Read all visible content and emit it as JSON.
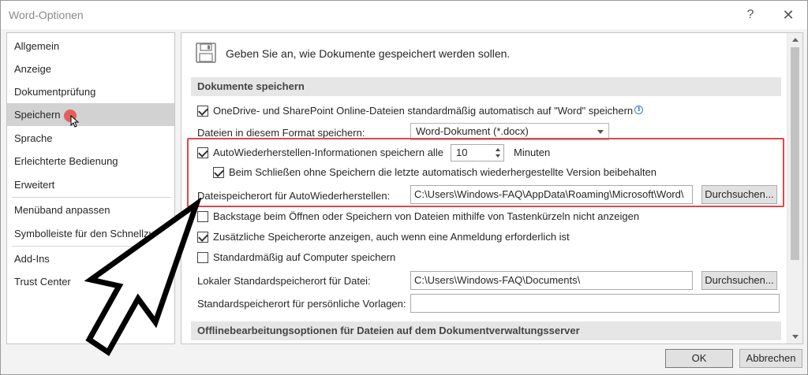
{
  "window": {
    "title": "Word-Optionen",
    "help_label": "?",
    "close_label": "✕"
  },
  "sidebar": {
    "items": [
      {
        "label": "Allgemein",
        "selected": false
      },
      {
        "label": "Anzeige",
        "selected": false
      },
      {
        "label": "Dokumentprüfung",
        "selected": false
      },
      {
        "label": "Speichern",
        "selected": true
      },
      {
        "label": "Sprache",
        "selected": false
      },
      {
        "label": "Erleichterte Bedienung",
        "selected": false
      },
      {
        "label": "Erweitert",
        "selected": false
      },
      {
        "label": "Menüband anpassen",
        "selected": false
      },
      {
        "label": "Symbolleiste für den Schnellzugriff",
        "selected": false
      },
      {
        "label": "Add-Ins",
        "selected": false
      },
      {
        "label": "Trust Center",
        "selected": false
      }
    ]
  },
  "main": {
    "header_icon": "floppy-disk-icon",
    "header_text": "Geben Sie an, wie Dokumente gespeichert werden sollen.",
    "section1_title": "Dokumente speichern",
    "onedrive_autosave": {
      "label": "OneDrive- und SharePoint Online-Dateien standardmäßig automatisch auf \"Word\" speichern",
      "checked": true,
      "info_icon": "i"
    },
    "format_label": "Dateien in diesem Format speichern:",
    "format_value": "Word-Dokument (*.docx)",
    "autorecover": {
      "label": "AutoWiederherstellen-Informationen speichern alle",
      "checked": true,
      "minutes_value": "10",
      "minutes_label": "Minuten"
    },
    "keep_last_autosaved": {
      "label": "Beim Schließen ohne Speichern die letzte automatisch wiederhergestellte Version beibehalten",
      "checked": true
    },
    "autorecover_location_label": "Dateispeicherort für AutoWiederherstellen:",
    "autorecover_location_value": "C:\\Users\\Windows-FAQ\\AppData\\Roaming\\Microsoft\\Word\\",
    "browse_label_1": "Durchsuchen...",
    "backstage": {
      "label": "Backstage beim Öffnen oder Speichern von Dateien mithilfe von Tastenkürzeln nicht anzeigen",
      "checked": false
    },
    "additional_locations": {
      "label": "Zusätzliche Speicherorte anzeigen, auch wenn eine Anmeldung erforderlich ist",
      "checked": true
    },
    "save_to_computer": {
      "label": "Standardmäßig auf Computer speichern",
      "checked": false
    },
    "local_default_label": "Lokaler Standardspeicherort für Datei:",
    "local_default_value": "C:\\Users\\Windows-FAQ\\Documents\\",
    "browse_label_2": "Durchsuchen...",
    "personal_templates_label": "Standardspeicherort für persönliche Vorlagen:",
    "personal_templates_value": "",
    "section2_title": "Offlinebearbeitungsoptionen für Dateien auf dem Dokumentverwaltungsserver"
  },
  "footer": {
    "ok_label": "OK",
    "cancel_label": "Abbrechen"
  },
  "colors": {
    "highlight": "#e0474c",
    "selected_nav": "#d2d2d2",
    "section_bar": "#e6e6e6"
  }
}
